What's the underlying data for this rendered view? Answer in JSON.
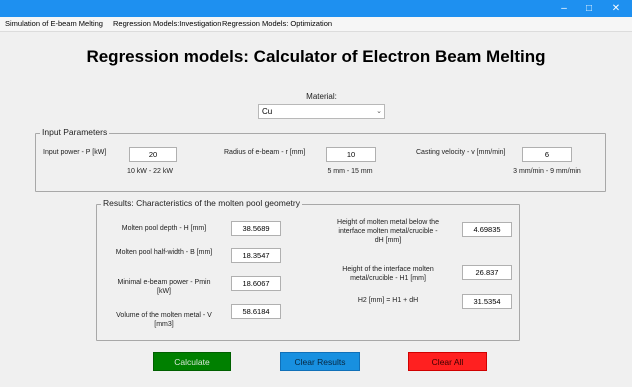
{
  "window": {
    "minimize_glyph": "–",
    "maximize_glyph": "□",
    "close_glyph": "✕",
    "titlebar_color": "#1e90f0"
  },
  "menu": {
    "items": [
      {
        "label": "Simulation of E-beam Melting"
      },
      {
        "label": "Regression Models:Investigation"
      },
      {
        "label": "Regression Models: Optimization"
      }
    ]
  },
  "page": {
    "title": "Regression models: Calculator of Electron Beam Melting"
  },
  "material": {
    "label": "Material:",
    "selected": "Cu"
  },
  "input_params": {
    "title": "Input Parameters",
    "power": {
      "label": "Input power - P [kW]",
      "value": "20",
      "range": "10 kW - 22 kW"
    },
    "radius": {
      "label": "Radius of e-beam - r [mm]",
      "value": "10",
      "range": "5 mm - 15 mm"
    },
    "velocity": {
      "label": "Casting velocity - v [mm/min]",
      "value": "6",
      "range": "3 mm/min - 9 mm/min"
    }
  },
  "results": {
    "title": "Results: Characteristics of the molten pool geometry",
    "depth": {
      "label": "Molten pool depth - H [mm]",
      "value": "38.5689"
    },
    "halfwidth": {
      "label": "Molten pool half-width - B [mm]",
      "value": "18.3547"
    },
    "pmin": {
      "label_line1": "Minimal e-beam power - Pmin",
      "label_line2": "[kW]",
      "value": "18.6067"
    },
    "volume": {
      "label_line1": "Volume of the molten metal - V",
      "label_line2": "[mm3]",
      "value": "58.6184"
    },
    "dh": {
      "label_line1": "Height of molten metal below the",
      "label_line2": "interface molten metal/crucible -",
      "label_line3": "dH [mm]",
      "value": "4.69835"
    },
    "h1": {
      "label_line1": "Height of the interface molten",
      "label_line2": "metal/crucible - H1 [mm]",
      "value": "26.837"
    },
    "h2": {
      "label": "H2 [mm] = H1 + dH",
      "value": "31.5354"
    }
  },
  "buttons": {
    "calculate": "Calculate",
    "clear_results": "Clear Results",
    "clear_all": "Clear All"
  }
}
